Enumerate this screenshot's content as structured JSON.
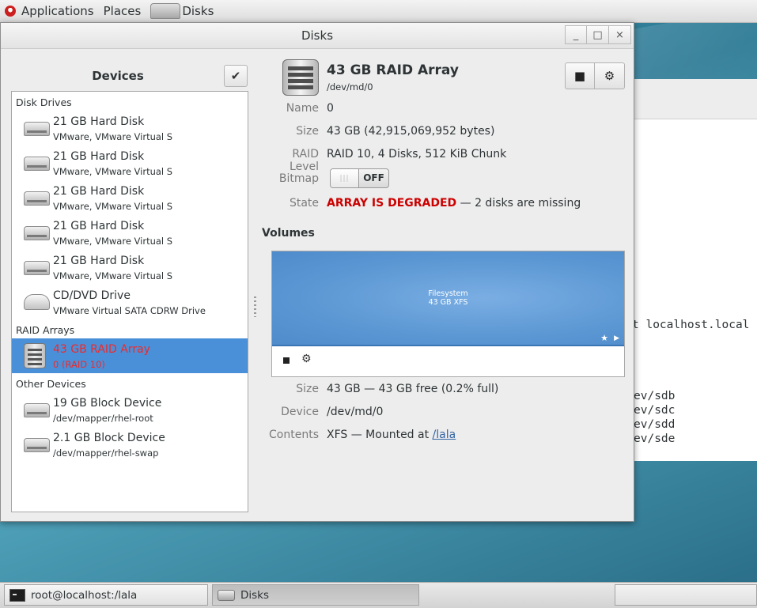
{
  "top_panel": {
    "applications": "Applications",
    "places": "Places",
    "active_app": "Disks"
  },
  "terminal_behind": {
    "lines": [
      "t localhost.local",
      "ev/sdb",
      "ev/sdc",
      "ev/sdd",
      "ev/sde"
    ]
  },
  "window": {
    "title": "Disks",
    "minimize": "_",
    "maximize": "□",
    "close": "×"
  },
  "sidebar": {
    "title": "Devices",
    "select_icon": "✔",
    "sections": {
      "disk_drives": "Disk Drives",
      "raid_arrays": "RAID Arrays",
      "other_devices": "Other Devices"
    },
    "disk_drives": [
      {
        "name": "21 GB Hard Disk",
        "sub": "VMware, VMware Virtual S"
      },
      {
        "name": "21 GB Hard Disk",
        "sub": "VMware, VMware Virtual S"
      },
      {
        "name": "21 GB Hard Disk",
        "sub": "VMware, VMware Virtual S"
      },
      {
        "name": "21 GB Hard Disk",
        "sub": "VMware, VMware Virtual S"
      },
      {
        "name": "21 GB Hard Disk",
        "sub": "VMware, VMware Virtual S"
      },
      {
        "name": "CD/DVD Drive",
        "sub": "VMware Virtual SATA CDRW Drive"
      }
    ],
    "raid_arrays": [
      {
        "name": "43 GB RAID Array",
        "sub": "0 (RAID 10)"
      }
    ],
    "other_devices": [
      {
        "name": "19 GB Block Device",
        "sub": "/dev/mapper/rhel-root"
      },
      {
        "name": "2.1 GB Block Device",
        "sub": "/dev/mapper/rhel-swap"
      }
    ]
  },
  "details": {
    "title": "43 GB RAID Array",
    "device_path": "/dev/md/0",
    "stop_icon": "■",
    "gear_icon": "⚙",
    "labels": {
      "name": "Name",
      "size": "Size",
      "raid_level": "RAID Level",
      "bitmap": "Bitmap",
      "state": "State"
    },
    "values": {
      "name": "0",
      "size": "43 GB (42,915,069,952 bytes)",
      "raid_level": "RAID 10, 4 Disks, 512 KiB Chunk",
      "bitmap": "OFF",
      "state_alert": "ARRAY IS DEGRADED",
      "state_rest": " — 2 disks are missing"
    }
  },
  "volumes": {
    "title": "Volumes",
    "bar_label_1": "Filesystem",
    "bar_label_2": "43 GB XFS",
    "labels": {
      "size": "Size",
      "device": "Device",
      "contents": "Contents"
    },
    "values": {
      "size": "43 GB — 43 GB free (0.2% full)",
      "device": "/dev/md/0",
      "contents_prefix": "XFS — Mounted at ",
      "mount_link": "/lala"
    }
  },
  "taskbar": {
    "task1": "root@localhost:/lala",
    "task2": "Disks"
  },
  "colors": {
    "selection": "#4a90d9",
    "degraded": "#cc0000",
    "volume_bar": "#5b97d3",
    "link": "#3465a4"
  }
}
